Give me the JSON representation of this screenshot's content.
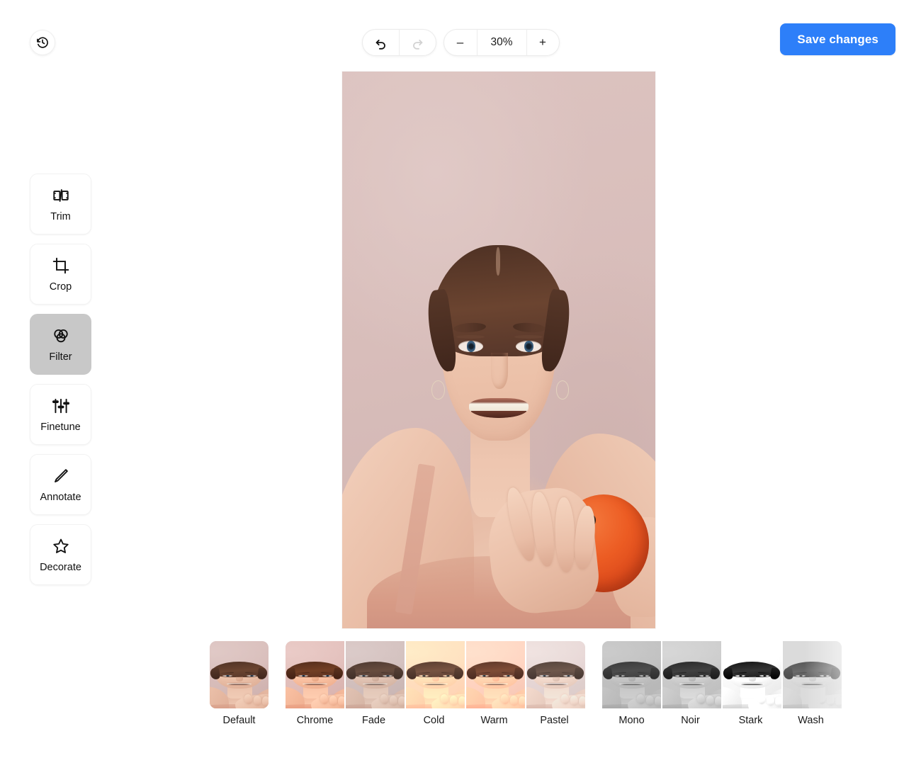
{
  "topbar": {
    "history_icon": "history-revert-icon",
    "undo_icon": "undo-arrow-icon",
    "redo_icon": "redo-arrow-icon",
    "zoom_out_label": "–",
    "zoom_level": "30%",
    "zoom_in_label": "+",
    "save_label": "Save changes",
    "accent_color": "#2d7ff9"
  },
  "sidebar": {
    "items": [
      {
        "label": "Trim",
        "icon": "film-trim-icon",
        "active": false
      },
      {
        "label": "Crop",
        "icon": "crop-icon",
        "active": false
      },
      {
        "label": "Filter",
        "icon": "filter-circles-icon",
        "active": true
      },
      {
        "label": "Finetune",
        "icon": "sliders-icon",
        "active": false
      },
      {
        "label": "Annotate",
        "icon": "pencil-icon",
        "active": false
      },
      {
        "label": "Decorate",
        "icon": "star-icon",
        "active": false
      }
    ],
    "active_bg": "#c8c8c8"
  },
  "canvas": {
    "subject": "portrait of a smiling woman holding an orange against a dusty pink wall",
    "background_color": "#d8bfbc"
  },
  "filters": {
    "selected": "Default",
    "groups": [
      {
        "items": [
          {
            "label": "Default",
            "fx": "fx-default"
          }
        ]
      },
      {
        "items": [
          {
            "label": "Chrome",
            "fx": "fx-chrome"
          },
          {
            "label": "Fade",
            "fx": "fx-fade"
          },
          {
            "label": "Cold",
            "fx": "fx-cold"
          },
          {
            "label": "Warm",
            "fx": "fx-warm"
          },
          {
            "label": "Pastel",
            "fx": "fx-pastel"
          }
        ]
      },
      {
        "items": [
          {
            "label": "Mono",
            "fx": "fx-mono"
          },
          {
            "label": "Noir",
            "fx": "fx-noir"
          },
          {
            "label": "Stark",
            "fx": "fx-stark"
          },
          {
            "label": "Wash",
            "fx": "fx-wash"
          }
        ]
      }
    ]
  }
}
